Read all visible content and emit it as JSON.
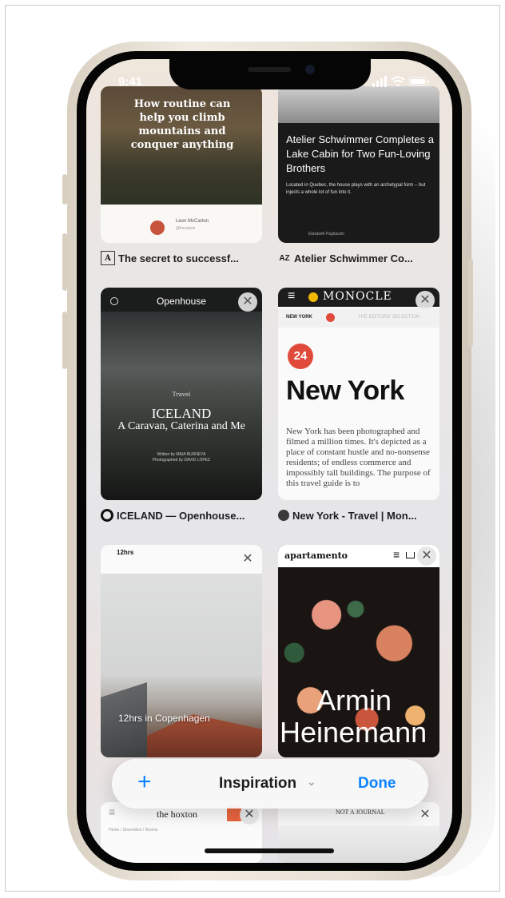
{
  "status_bar": {
    "time": "9:41"
  },
  "tabs": [
    {
      "title_caption": "The secret to successf...",
      "favicon_text": "A",
      "headline": "How routine can help you climb mountains and conquer anything",
      "byline": "Leon McCarton",
      "handle": "@lmcarton"
    },
    {
      "title_caption": "Atelier Schwimmer Co...",
      "favicon_text": "AZ",
      "headline": "Atelier Schwimmer Completes a Lake Cabin for Two Fun-Loving Brothers",
      "body": "Located in Quebec, the house plays with an archetypal form – but injects a whole lot of fun into it.",
      "credit": "Elizabeth Pagliacolo"
    },
    {
      "title_caption": "ICELAND — Openhouse...",
      "site_name": "Openhouse",
      "section": "Travel",
      "headline": "ICELAND",
      "subtitle": "A Caravan, Caterina and Me",
      "credits": "Written by MAIA BURNEYA\nPhotographed by DAVID LOPEZ"
    },
    {
      "title_caption": "New York - Travel | Mon...",
      "site_name": "MONOCLE",
      "tab_label": "NEW YORK",
      "tab_label_2": "THE EDITORS' SELECTION",
      "number": "24",
      "headline": "New York",
      "body": "New York has been photographed and filmed a million times. It's depicted as a place of constant hustle and no-nonsense residents; of endless commerce and impossibly tall buildings. The purpose of this travel guide is to"
    },
    {
      "title_caption": "",
      "logo": "12hrs",
      "overlay": "12hrs in Copenhagen"
    },
    {
      "title_caption": "",
      "site_name": "apartamento",
      "overlay_line1": "Armin",
      "overlay_line2": "Heinemann"
    },
    {
      "title_caption": "",
      "site_name": "the hoxton",
      "breadcrumb": "Home / Shoreditch / Rooms"
    },
    {
      "title_caption": "",
      "site_name": "NOT A JOURNAL"
    }
  ],
  "toolbar": {
    "add_label": "+",
    "group_name": "Inspiration",
    "chevron": "⌄",
    "done_label": "Done"
  },
  "icons": {
    "close": "✕",
    "menu": "≡"
  }
}
